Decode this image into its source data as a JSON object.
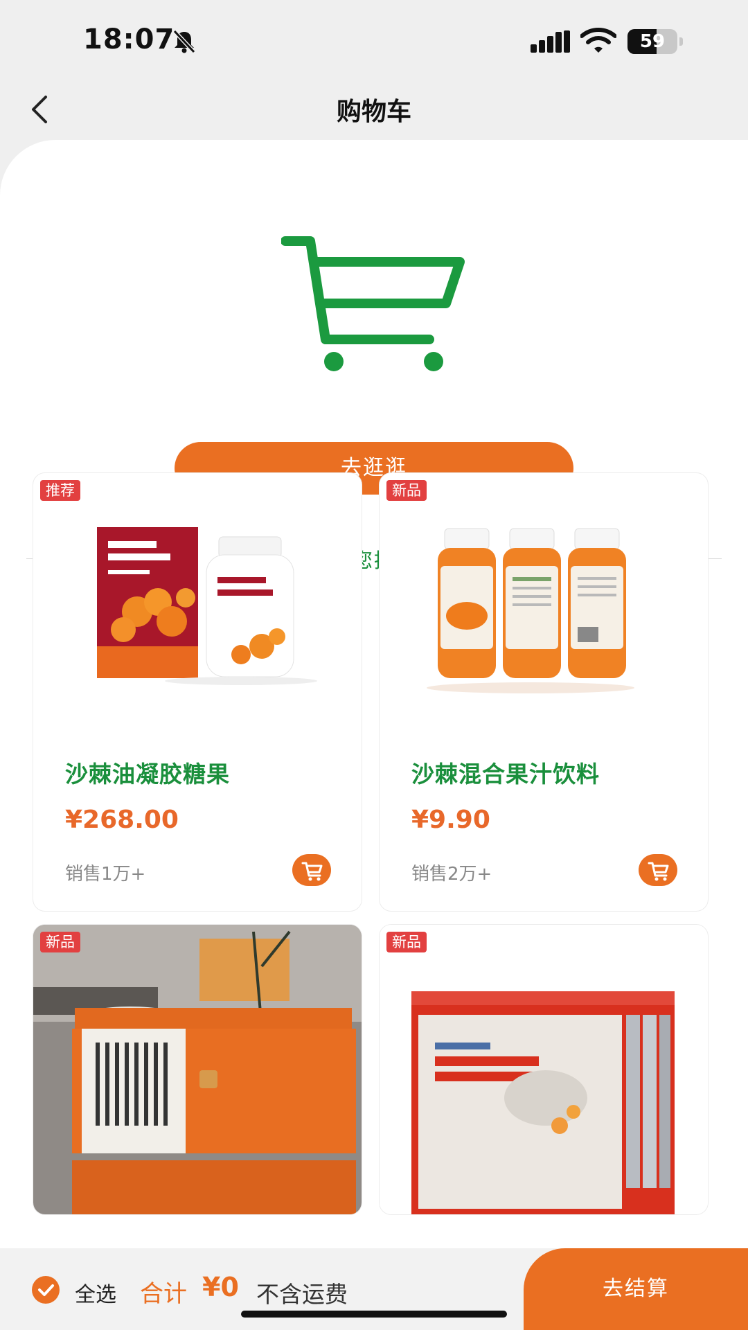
{
  "status_bar": {
    "time": "18:07",
    "battery": "59",
    "battery_level": 0.59
  },
  "nav": {
    "title": "购物车"
  },
  "empty_cart": {
    "button_label": "去逛逛"
  },
  "recommend": {
    "title": "为您推荐"
  },
  "products": [
    {
      "tag": "推荐",
      "name": "沙棘油凝胶糖果",
      "price": "¥268.00",
      "sales": "销售1万+"
    },
    {
      "tag": "新品",
      "name": "沙棘混合果汁饮料",
      "price": "¥9.90",
      "sales": "销售2万+"
    },
    {
      "tag": "新品"
    },
    {
      "tag": "新品"
    }
  ],
  "bottom_bar": {
    "select_all": "全选",
    "total_label": "合计",
    "total_value": "¥0",
    "shipping_note": "不含运费",
    "checkout": "去结算"
  },
  "colors": {
    "accent": "#ea6f22",
    "green": "#1a8f3c",
    "tag_red": "#e24040"
  },
  "icons": {
    "back": "chevron-left-icon",
    "cart": "cart-icon",
    "bell": "bell-muted-icon",
    "signal": "signal-icon",
    "wifi": "wifi-icon",
    "check": "check-icon"
  }
}
